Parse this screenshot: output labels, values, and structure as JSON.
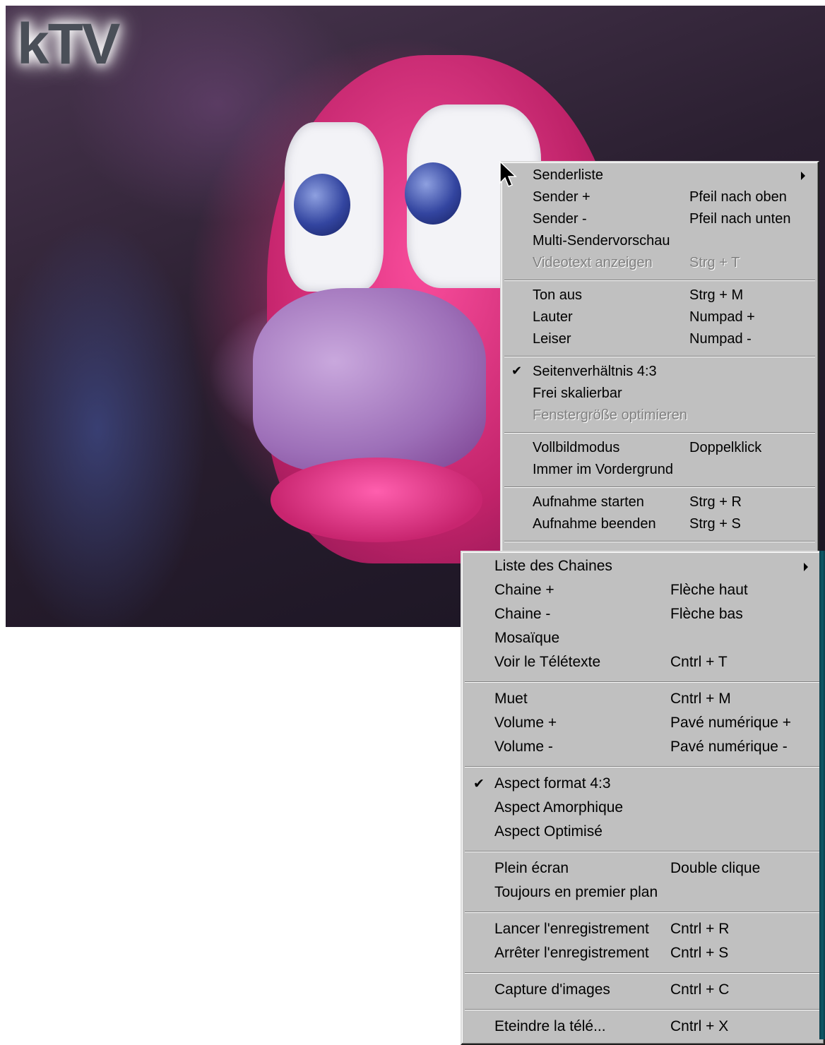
{
  "app": {
    "logo": "kTV"
  },
  "menu_de": {
    "items": [
      {
        "label": "Senderliste",
        "shortcut": "",
        "submenu": true
      },
      {
        "label": "Sender +",
        "shortcut": "Pfeil nach oben"
      },
      {
        "label": "Sender -",
        "shortcut": "Pfeil nach unten"
      },
      {
        "label": "Multi-Sendervorschau",
        "shortcut": ""
      },
      {
        "label": "Videotext anzeigen",
        "shortcut": "Strg + T",
        "disabled": true
      },
      {
        "label": "Ton aus",
        "shortcut": "Strg + M"
      },
      {
        "label": "Lauter",
        "shortcut": "Numpad +"
      },
      {
        "label": "Leiser",
        "shortcut": "Numpad -"
      },
      {
        "label": "Seitenverhältnis 4:3",
        "shortcut": "",
        "checked": true
      },
      {
        "label": "Frei skalierbar",
        "shortcut": ""
      },
      {
        "label": "Fenstergröße optimieren",
        "shortcut": "",
        "disabled": true
      },
      {
        "label": "Vollbildmodus",
        "shortcut": "Doppelklick"
      },
      {
        "label": "Immer im Vordergrund",
        "shortcut": ""
      },
      {
        "label": "Aufnahme starten",
        "shortcut": "Strg + R"
      },
      {
        "label": "Aufnahme beenden",
        "shortcut": "Strg + S"
      }
    ]
  },
  "menu_fr": {
    "items": [
      {
        "label": "Liste des Chaines",
        "shortcut": "",
        "submenu": true
      },
      {
        "label": "Chaine +",
        "shortcut": "Flèche haut"
      },
      {
        "label": "Chaine -",
        "shortcut": "Flèche bas"
      },
      {
        "label": "Mosaïque",
        "shortcut": ""
      },
      {
        "label": "Voir le Télétexte",
        "shortcut": "Cntrl + T"
      },
      {
        "label": "Muet",
        "shortcut": "Cntrl + M"
      },
      {
        "label": "Volume +",
        "shortcut": "Pavé numérique +"
      },
      {
        "label": "Volume -",
        "shortcut": "Pavé numérique -"
      },
      {
        "label": "Aspect format 4:3",
        "shortcut": "",
        "checked": true
      },
      {
        "label": "Aspect Amorphique",
        "shortcut": ""
      },
      {
        "label": "Aspect Optimisé",
        "shortcut": ""
      },
      {
        "label": "Plein écran",
        "shortcut": "Double clique"
      },
      {
        "label": "Toujours en premier plan",
        "shortcut": ""
      },
      {
        "label": "Lancer l'enregistrement",
        "shortcut": "Cntrl + R"
      },
      {
        "label": "Arrêter l'enregistrement",
        "shortcut": "Cntrl + S"
      },
      {
        "label": "Capture d'images",
        "shortcut": "Cntrl + C"
      },
      {
        "label": "Eteindre la télé...",
        "shortcut": "Cntrl + X"
      }
    ]
  },
  "icons": {
    "check": "✔",
    "submenu_arrow": "triangle-right",
    "cursor": "arrow-cursor"
  }
}
